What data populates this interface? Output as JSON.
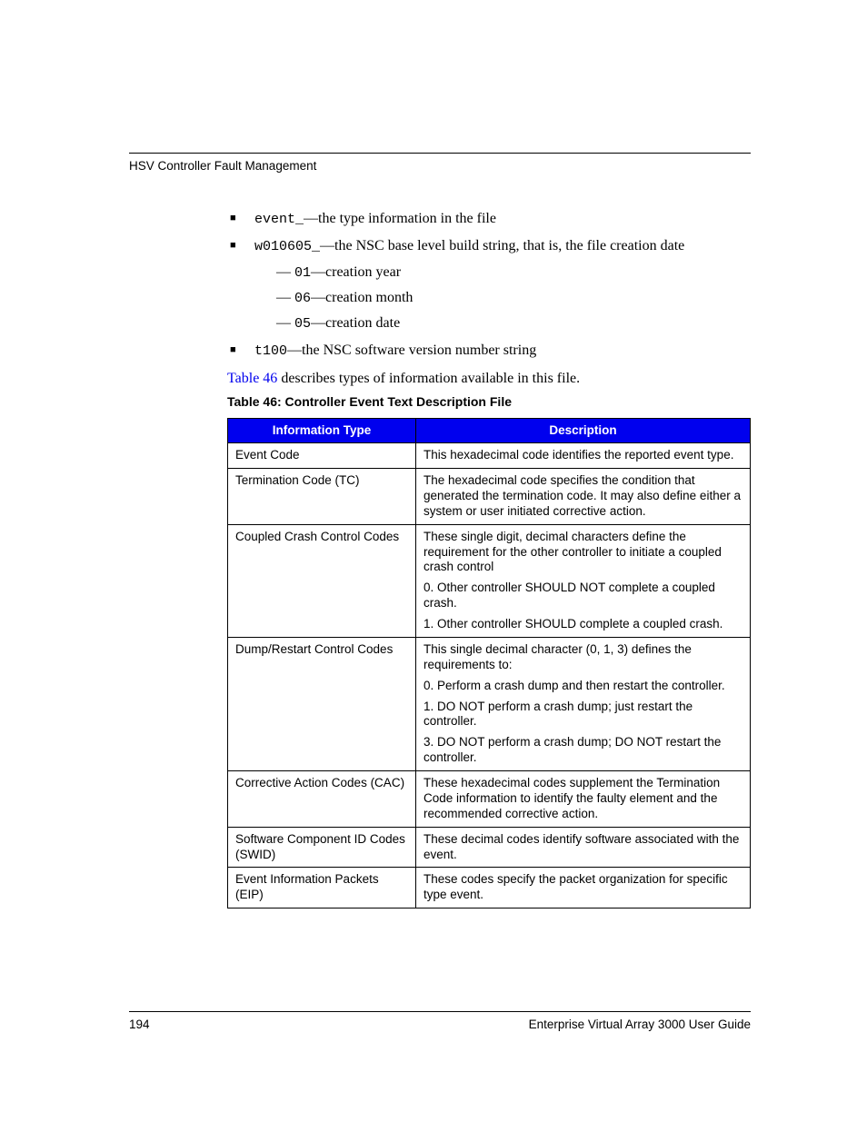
{
  "header": {
    "title": "HSV Controller Fault Management"
  },
  "bullets": {
    "b1": {
      "code": "event_",
      "text": "—the type information in the file"
    },
    "b2": {
      "code": "w010605_",
      "text": "—the NSC base level build string, that is, the file creation date",
      "sub": {
        "s1": {
          "code": "01",
          "text": "—creation year"
        },
        "s2": {
          "code": "06",
          "text": "—creation month"
        },
        "s3": {
          "code": "05",
          "text": "—creation date"
        }
      }
    },
    "b3": {
      "code": "t100",
      "text": "—the NSC software version number string"
    }
  },
  "para": {
    "link": "Table 46",
    "rest": " describes types of information available in this file."
  },
  "table_caption": "Table 46:  Controller Event Text Description File",
  "table": {
    "head": {
      "col1": "Information Type",
      "col2": "Description"
    },
    "rows": {
      "r1": {
        "type": "Event Code",
        "p1": "This hexadecimal code identifies the reported event type."
      },
      "r2": {
        "type": "Termination Code (TC)",
        "p1": "The hexadecimal code specifies the condition that generated the termination code. It may also define either a system or user initiated corrective action."
      },
      "r3": {
        "type": "Coupled Crash Control Codes",
        "p1": "These single digit, decimal characters define the requirement for the other controller to initiate a coupled crash control",
        "p2": "0. Other controller SHOULD NOT complete a coupled crash.",
        "p3": "1. Other controller SHOULD complete a coupled crash."
      },
      "r4": {
        "type": "Dump/Restart Control Codes",
        "p1": "This single decimal character (0, 1, 3) defines the requirements to:",
        "p2": "0. Perform a crash dump and then restart the controller.",
        "p3": "1. DO NOT perform a crash dump; just restart the controller.",
        "p4": "3. DO NOT perform a crash dump; DO NOT restart the controller."
      },
      "r5": {
        "type": "Corrective Action Codes (CAC)",
        "p1": "These hexadecimal codes supplement the Termination Code information to identify the faulty element and the recommended corrective action."
      },
      "r6": {
        "type": "Software Component ID Codes (SWID)",
        "p1": "These decimal codes identify software associated with the event."
      },
      "r7": {
        "type": "Event Information Packets (EIP)",
        "p1": "These codes specify the packet organization for specific type event."
      }
    }
  },
  "footer": {
    "page": "194",
    "title": "Enterprise Virtual Array 3000 User Guide"
  }
}
